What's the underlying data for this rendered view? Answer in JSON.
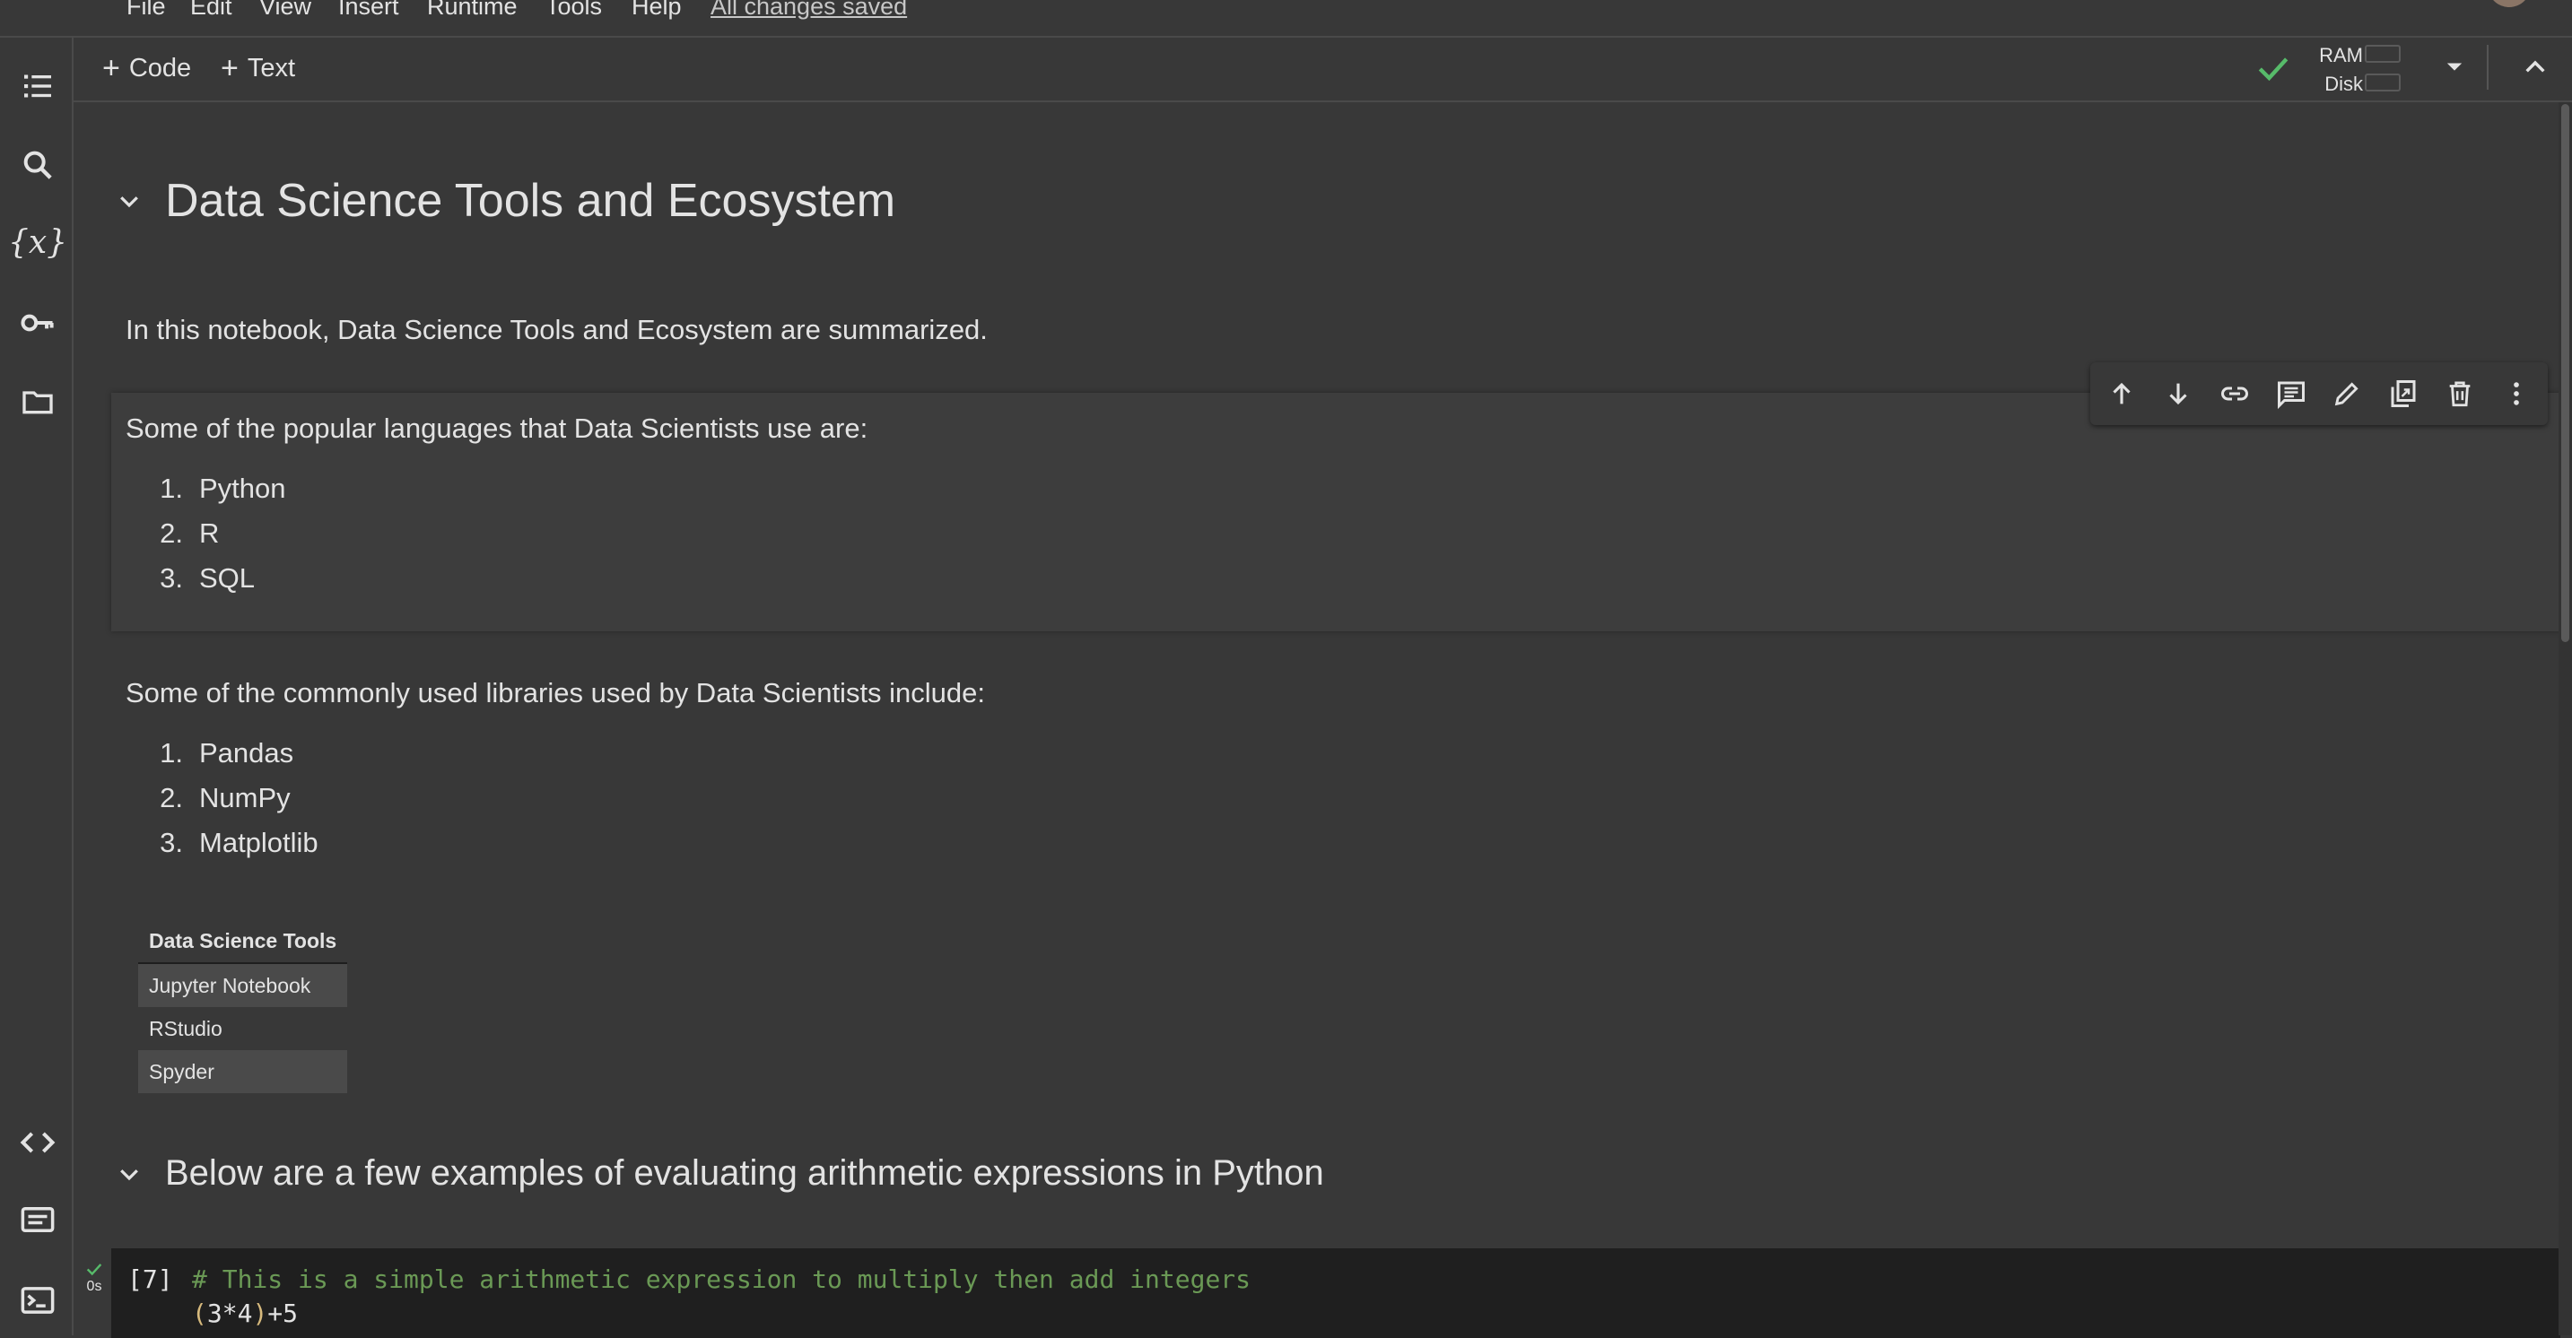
{
  "menubar": {
    "items": [
      "File",
      "Edit",
      "View",
      "Insert",
      "Runtime",
      "Tools",
      "Help"
    ],
    "save_status": "All changes saved"
  },
  "toolbar": {
    "add_code": "Code",
    "add_text": "Text",
    "ram_label": "RAM",
    "disk_label": "Disk",
    "connected_color": "#57bb6a"
  },
  "rail": {
    "icons": [
      "table-of-contents-icon",
      "search-icon",
      "variables-icon",
      "secrets-key-icon",
      "files-folder-icon",
      "code-snippets-icon",
      "command-palette-icon",
      "terminal-icon"
    ],
    "variables_glyph": "{x}"
  },
  "notebook": {
    "title": "Data Science Tools and Ecosystem",
    "intro": "In this notebook, Data Science Tools and Ecosystem are summarized.",
    "languages_heading": "Some of the popular languages that Data Scientists use are:",
    "languages": [
      "Python",
      "R",
      "SQL"
    ],
    "libraries_heading": "Some of the commonly used libraries used by Data Scientists include:",
    "libraries": [
      "Pandas",
      "NumPy",
      "Matplotlib"
    ],
    "tools_table": {
      "header": "Data Science Tools",
      "rows": [
        "Jupyter Notebook",
        "RStudio",
        "Spyder"
      ]
    },
    "section2_title": "Below are a few examples of evaluating arithmetic expressions in Python",
    "code_cell": {
      "exec_count": "[7]",
      "run_time": "0s",
      "comment_line": "# This is a simple arithmetic expression to multiply then add integers",
      "expr_open": "(",
      "expr_body": "3*4",
      "expr_close": ")",
      "expr_tail": "+5"
    }
  },
  "list_markers": [
    "1.",
    "2.",
    "3."
  ],
  "cell_toolbar": [
    "move-cell-up-icon",
    "move-cell-down-icon",
    "copy-link-icon",
    "add-comment-icon",
    "edit-cell-icon",
    "mirror-cell-icon",
    "delete-cell-icon",
    "more-options-icon"
  ]
}
